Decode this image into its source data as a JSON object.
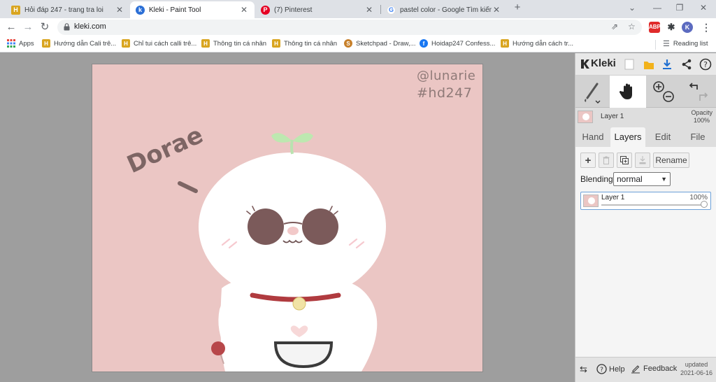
{
  "browser": {
    "tabs": [
      {
        "title": "Hỏi đáp 247 - trang tra loi",
        "favicon": "hoidap-h-icon",
        "color": "#d9a520"
      },
      {
        "title": "Kleki - Paint Tool",
        "favicon": "kleki-icon",
        "color": "#2b6fd6"
      },
      {
        "title": "(7) Pinterest",
        "favicon": "pinterest-icon",
        "color": "#e60023"
      },
      {
        "title": "pastel color - Google Tìm kiếm",
        "favicon": "google-icon",
        "color": "#4285f4"
      }
    ],
    "new_tab": "+",
    "url": "kleki.com",
    "profile_initial": "K",
    "abp_label": "ABP",
    "bookmarks": [
      {
        "label": "Apps"
      },
      {
        "label": "Hướng dẫn Cali trê..."
      },
      {
        "label": "Chỉ tui cách calli trê..."
      },
      {
        "label": "Thông tin cá nhân"
      },
      {
        "label": "Thông tin cá nhân"
      },
      {
        "label": "Sketchpad - Draw,..."
      },
      {
        "label": "Hoidap247 Confess..."
      },
      {
        "label": "Hướng dẫn cách tr..."
      }
    ],
    "reading_list": "Reading list"
  },
  "artwork": {
    "signature_line1": "@lunarie",
    "signature_line2": "#hd247",
    "name_text": "Dorae",
    "background": "#ebc6c4"
  },
  "panel": {
    "brand": "Kleki",
    "layer_name": "Layer 1",
    "opacity_label": "Opacity",
    "opacity_value": "100%",
    "tabs": [
      "Hand",
      "Layers",
      "Edit",
      "File"
    ],
    "rename_label": "Rename",
    "blending_label": "Blending",
    "blending_value": "normal",
    "layer_row_name": "Layer 1",
    "layer_row_opacity": "100%",
    "help_label": "Help",
    "feedback_label": "Feedback",
    "updated_label": "updated",
    "updated_date": "2021-06-16"
  }
}
